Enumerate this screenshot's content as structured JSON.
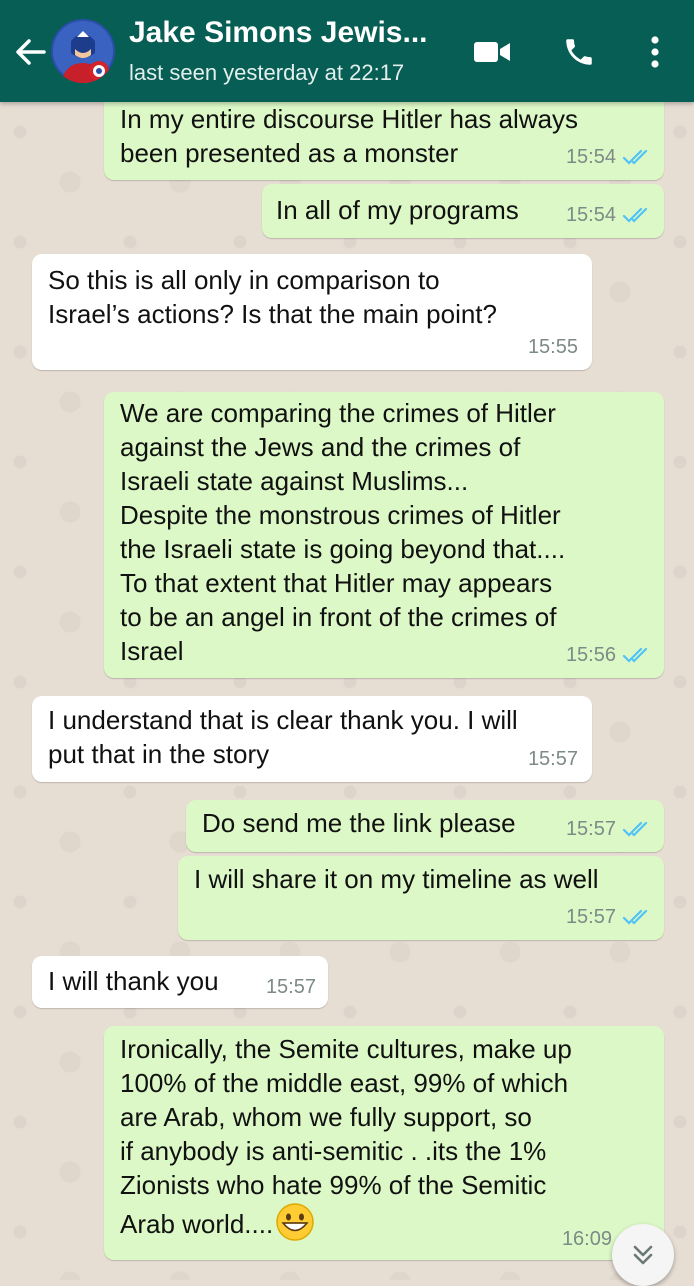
{
  "header": {
    "contact_name": "Jake Simons Jewis...",
    "last_seen": "last seen yesterday at 22:17",
    "icons": [
      "back-arrow-icon",
      "video-call-icon",
      "phone-icon",
      "more-vert-icon"
    ]
  },
  "colors": {
    "header": "#075e54",
    "outgoing_bubble": "#dcf8c6",
    "incoming_bubble": "#ffffff",
    "read_ticks": "#4fc3f7",
    "chat_background": "#e6ddd3"
  },
  "messages": [
    {
      "direction": "out",
      "text": "In my entire discourse Hitler has always\nbeen presented as a monster",
      "time": "15:54",
      "status": "read"
    },
    {
      "direction": "out",
      "text": "In all of my programs",
      "time": "15:54",
      "status": "read"
    },
    {
      "direction": "in",
      "text": "So this is all only in comparison to\nIsrael’s actions? Is that the main point?",
      "time": "15:55"
    },
    {
      "direction": "out",
      "text": "We are comparing the crimes of Hitler\nagainst the Jews and the crimes of\nIsraeli state against Muslims...\nDespite the monstrous crimes of Hitler\nthe Israeli state is going beyond that....\nTo that extent that Hitler may appears\nto be an angel in front of the crimes of\nIsrael",
      "time": "15:56",
      "status": "read"
    },
    {
      "direction": "in",
      "text": "I understand that is clear thank you. I will\nput that in the story",
      "time": "15:57"
    },
    {
      "direction": "out",
      "text": "Do send me the link please",
      "time": "15:57",
      "status": "read"
    },
    {
      "direction": "out",
      "text": "I will share it on my timeline as well",
      "time": "15:57",
      "status": "read"
    },
    {
      "direction": "in",
      "text": "I will thank you",
      "time": "15:57"
    },
    {
      "direction": "out",
      "text": "Ironically, the Semite cultures, make up\n100% of the middle east, 99% of which\nare Arab, whom we fully support, so\nif anybody is anti-semitic . .its the 1%\nZionists who hate 99% of the Semitic\nArab world....",
      "emoji": "grinning-face-emoji",
      "time": "16:09",
      "status": "read"
    }
  ],
  "scroll_button_icon": "double-chevron-down-icon"
}
